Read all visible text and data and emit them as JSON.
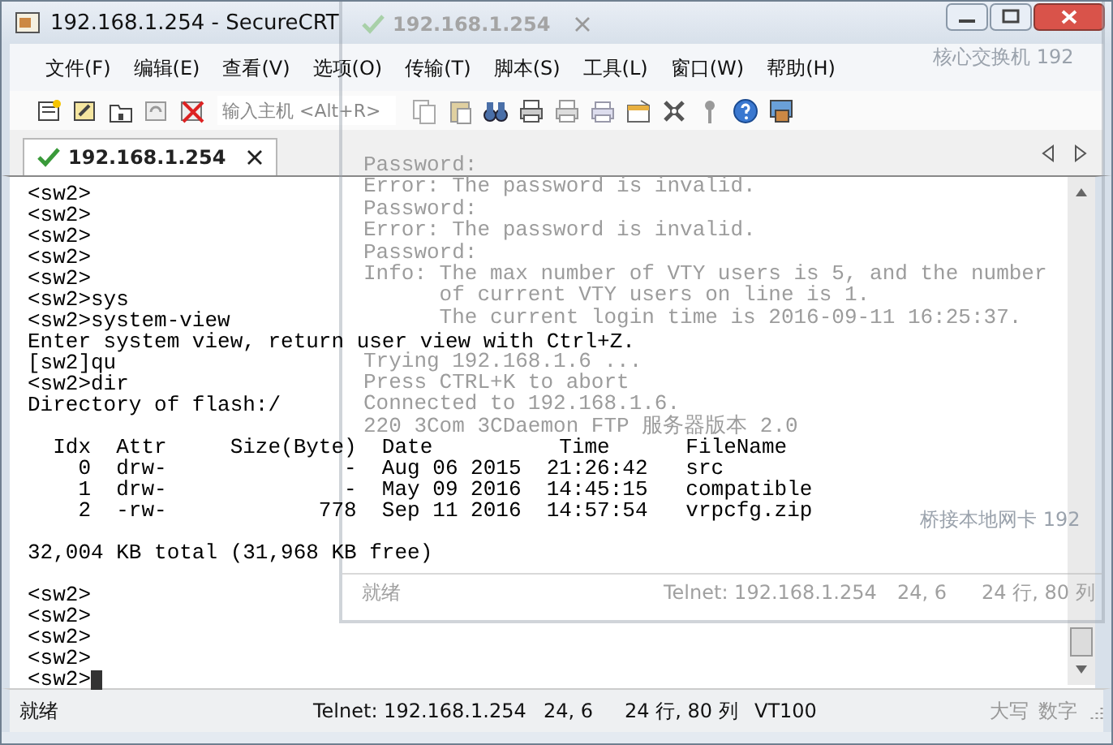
{
  "window": {
    "title": "192.168.1.254 - SecureCRT"
  },
  "menu": [
    "文件(F)",
    "编辑(E)",
    "查看(V)",
    "选项(O)",
    "传输(T)",
    "脚本(S)",
    "工具(L)",
    "窗口(W)",
    "帮助(H)"
  ],
  "toolbar": {
    "host_field": {
      "placeholder": "输入主机 <Alt+R>"
    }
  },
  "tabs": [
    {
      "label": "192.168.1.254",
      "selected": true
    }
  ],
  "terminal": {
    "cursor": true,
    "blocks": [
      [
        "<sw2>",
        "<sw2>",
        "<sw2>",
        "<sw2>",
        "<sw2>",
        "<sw2>sys",
        "<sw2>system-view",
        "Enter system view, return user view with Ctrl+Z.",
        "[sw2]qu",
        "<sw2>dir",
        "Directory of flash:/"
      ],
      [
        "  Idx  Attr     Size(Byte)  Date          Time      FileName",
        "    0  drw-              -  Aug 06 2015  21:26:42   src",
        "    1  drw-              -  May 09 2016  14:45:15   compatible",
        "    2  -rw-            778  Sep 11 2016  14:57:54   vrpcfg.zip"
      ],
      [
        "32,004 KB total (31,968 KB free)"
      ],
      [
        "<sw2>",
        "<sw2>",
        "<sw2>",
        "<sw2>",
        "<sw2>"
      ]
    ]
  },
  "status_bar": {
    "items": [
      "就绪",
      "Telnet: 192.168.1.254",
      "24,  6",
      "24 行, 80 列",
      "VT100"
    ],
    "indicators": [
      {
        "label": "大写",
        "disabled": true
      },
      {
        "label": "数字",
        "disabled": true
      }
    ]
  },
  "background_window": {
    "tab": "192.168.1.254",
    "blocks": [
      [
        "Password:",
        "Error: The password is invalid.",
        "Password:",
        "Error: The password is invalid.",
        "Password:",
        "Info: The max number of VTY users is 5, and the number",
        "      of current VTY users on line is 1.",
        "      The current login time is 2016-09-11 16:25:37."
      ],
      [
        "Trying 192.168.1.6 ...",
        "Press CTRL+K to abort",
        "Connected to 192.168.1.6.",
        "220 3Com 3CDaemon FTP 服务器版本 2.0"
      ]
    ],
    "status_bar": [
      "就绪",
      "Telnet: 192.168.1.254",
      "24,  6",
      "24 行, 80 列"
    ]
  },
  "backdrop_labels": [
    "核心交换机 192",
    "桥接本地网卡 192"
  ]
}
